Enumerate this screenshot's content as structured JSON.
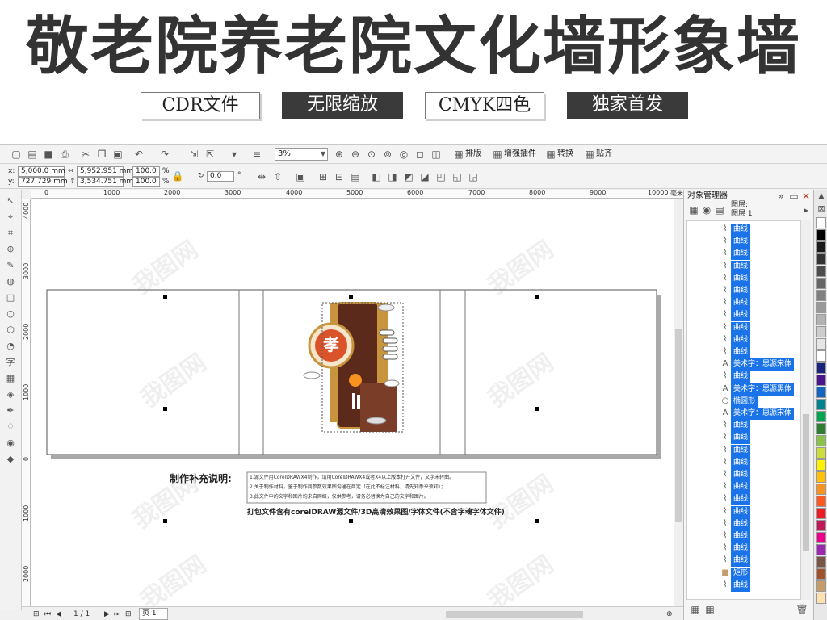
{
  "banner": {
    "title": "敬老院养老院文化墙形象墙",
    "tags": [
      {
        "label": "CDR文件",
        "style": "outline"
      },
      {
        "label": "无限缩放",
        "style": "fill"
      },
      {
        "label": "CMYK四色",
        "style": "outline"
      },
      {
        "label": "独家首发",
        "style": "fill"
      }
    ]
  },
  "toolbar": {
    "zoom": "3%",
    "buttons": {
      "arrange": "排版",
      "plugin": "增强插件",
      "convert": "转换",
      "snap": "贴齐"
    }
  },
  "property_bar": {
    "x": "5,000.0 mm",
    "y": "727.729 mm",
    "width": "5,952.951 mm",
    "height": "3,534.751 mm",
    "scale_w": "100.0",
    "scale_h": "100.0",
    "percent": "%",
    "rotation": "0.0",
    "deg": "°"
  },
  "ruler": {
    "h_ticks": [
      "0",
      "1000",
      "2000",
      "3000",
      "4000",
      "5000",
      "6000",
      "7000",
      "8000",
      "9000",
      "10000"
    ],
    "unit": "毫米",
    "v_ticks": [
      "4000",
      "3000",
      "2000",
      "1000",
      "0",
      "1000",
      "2000"
    ]
  },
  "canvas": {
    "notes_title": "制作补充说明:",
    "notes": [
      "1.源文件用CorelDRAWX4制作，请用CorelDRAWX4或者X4以上版本打开文件，文字未转曲。",
      "2.关于制作材料，鉴于制作商参数效果图沟通在商定（在此不标注材料，请先知悉来须知）；",
      "3.此文件中的文字和图片均来自网络，仅供参考，请务必替换为自己的文字和图片。"
    ],
    "package_text": "打包文件含有coreIDRAW源文件/3D高清效果图/字体文件(不含字魂字体文件)",
    "emblem_char": "孝"
  },
  "statusbar": {
    "page_count": "1 / 1",
    "page_tab": "页 1"
  },
  "object_manager": {
    "title": "对象管理器",
    "layer_label": "图层:",
    "layer_name": "图层 1",
    "items": [
      {
        "icon": "curve",
        "label": "曲线"
      },
      {
        "icon": "curve",
        "label": "曲线"
      },
      {
        "icon": "curve",
        "label": "曲线"
      },
      {
        "icon": "curve",
        "label": "曲线"
      },
      {
        "icon": "curve",
        "label": "曲线"
      },
      {
        "icon": "curve",
        "label": "曲线"
      },
      {
        "icon": "curve",
        "label": "曲线"
      },
      {
        "icon": "curve",
        "label": "曲线"
      },
      {
        "icon": "curve",
        "label": "曲线"
      },
      {
        "icon": "curve",
        "label": "曲线"
      },
      {
        "icon": "curve",
        "label": "曲线"
      },
      {
        "icon": "text",
        "label": "美术字：思源宋体"
      },
      {
        "icon": "curve",
        "label": "曲线"
      },
      {
        "icon": "text",
        "label": "美术字：思源黑体"
      },
      {
        "icon": "ellipse",
        "label": "椭圆形"
      },
      {
        "icon": "text",
        "label": "美术字：思源宋体"
      },
      {
        "icon": "curve",
        "label": "曲线"
      },
      {
        "icon": "curve",
        "label": "曲线"
      },
      {
        "icon": "curve",
        "label": "曲线"
      },
      {
        "icon": "curve",
        "label": "曲线"
      },
      {
        "icon": "curve",
        "label": "曲线"
      },
      {
        "icon": "curve",
        "label": "曲线"
      },
      {
        "icon": "curve",
        "label": "曲线"
      },
      {
        "icon": "curve",
        "label": "曲线"
      },
      {
        "icon": "curve",
        "label": "曲线"
      },
      {
        "icon": "curve",
        "label": "曲线"
      },
      {
        "icon": "curve",
        "label": "曲线"
      },
      {
        "icon": "curve",
        "label": "曲线"
      },
      {
        "icon": "rect",
        "label": "矩形"
      },
      {
        "icon": "curve",
        "label": "曲线"
      }
    ]
  },
  "palette": [
    "#ffffff",
    "#000000",
    "#1a1a1a",
    "#333333",
    "#4d4d4d",
    "#666666",
    "#808080",
    "#999999",
    "#b3b3b3",
    "#cccccc",
    "#e6e6e6",
    "#ffffff",
    "#1a237e",
    "#4a148c",
    "#1565c0",
    "#00838f",
    "#00a651",
    "#2e7d32",
    "#8bc34a",
    "#cddc39",
    "#fff200",
    "#ffc107",
    "#f7931e",
    "#ff5722",
    "#ed1c24",
    "#c2185b",
    "#ec008c",
    "#9c27b0",
    "#795548",
    "#a0522d",
    "#c69c6d",
    "#ffe0b2"
  ],
  "watermark": "我图网"
}
